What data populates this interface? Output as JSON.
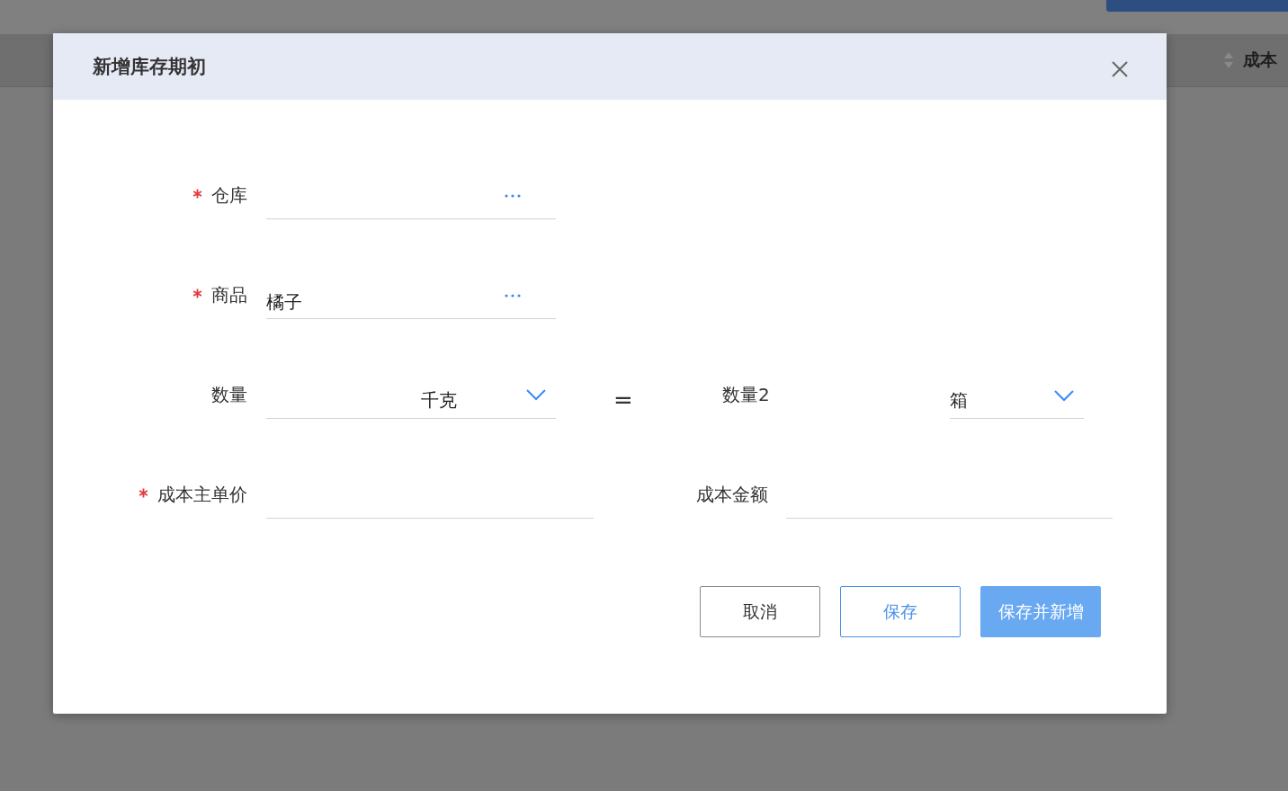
{
  "background": {
    "column_header": "成本"
  },
  "dialog": {
    "title": "新增库存期初",
    "rows": [
      {
        "fields": [
          {
            "kind": "lookup",
            "label": "仓库",
            "required": true
          }
        ]
      },
      {
        "fields": [
          {
            "kind": "lookup",
            "label": "商品",
            "required": true,
            "value": "橘子"
          }
        ]
      },
      {
        "separator": "=",
        "fields": [
          {
            "kind": "unit",
            "label": "数量",
            "required": false,
            "unit": "千克"
          },
          {
            "kind": "unit",
            "label": "数量2",
            "required": false,
            "unit": "箱"
          }
        ]
      },
      {
        "fields": [
          {
            "kind": "text",
            "label": "成本主单价",
            "required": true
          },
          {
            "kind": "text",
            "label": "成本金额",
            "required": false
          }
        ]
      }
    ],
    "buttons": [
      {
        "label": "取消",
        "kind": "default"
      },
      {
        "label": "保存",
        "kind": "outline"
      },
      {
        "label": "保存并新增",
        "kind": "primary"
      }
    ]
  }
}
